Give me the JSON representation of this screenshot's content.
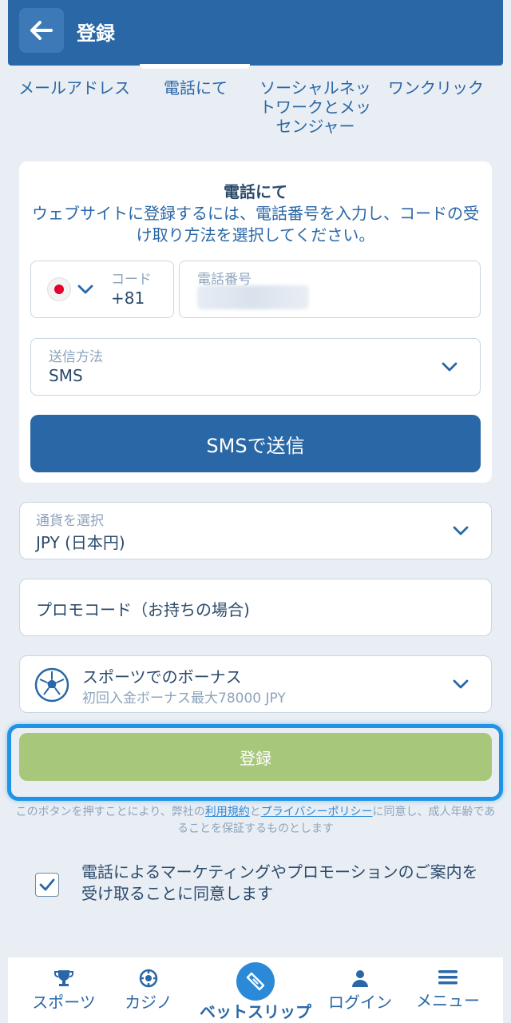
{
  "header": {
    "title": "登録"
  },
  "tabs": [
    {
      "label": "メールアドレス"
    },
    {
      "label": "電話にて"
    },
    {
      "label": "ソーシャルネットワークとメッセンジャー"
    },
    {
      "label": "ワンクリック"
    }
  ],
  "card": {
    "title": "電話にて",
    "description": "ウェブサイトに登録するには、電話番号を入力し、コードの受け取り方法を選択してください。",
    "code_label": "コード",
    "code_value": "+81",
    "phone_label": "電話番号",
    "send_method_label": "送信方法",
    "send_method_value": "SMS",
    "send_button": "SMSで送信"
  },
  "currency": {
    "label": "通貨を選択",
    "value": "JPY (日本円)"
  },
  "promo": {
    "placeholder": "プロモコード（お持ちの場合)"
  },
  "bonus": {
    "title": "スポーツでのボーナス",
    "subtitle": "初回入金ボーナス最大78000 JPY"
  },
  "register_button": "登録",
  "terms": {
    "prefix": "このボタンを押すことにより、弊社の",
    "terms_link": "利用規約",
    "and": "と",
    "privacy_link": "プライバシーポリシー",
    "suffix": "に同意し、成人年齢であることを保証するものとします"
  },
  "consent": {
    "text": "電話によるマーケティングやプロモーションのご案内を受け取ることに同意します",
    "checked": true
  },
  "bottom_nav": [
    {
      "label": "スポーツ",
      "icon": "trophy-icon"
    },
    {
      "label": "カジノ",
      "icon": "casino-chip-icon"
    },
    {
      "label": "ベットスリップ",
      "icon": "ticket-icon"
    },
    {
      "label": "ログイン",
      "icon": "user-icon"
    },
    {
      "label": "メニュー",
      "icon": "menu-icon"
    }
  ],
  "colors": {
    "primary": "#2a67a6",
    "register_disabled": "#a7c77a",
    "focus_ring": "#1f93e6",
    "flag_red": "#e4002b"
  }
}
